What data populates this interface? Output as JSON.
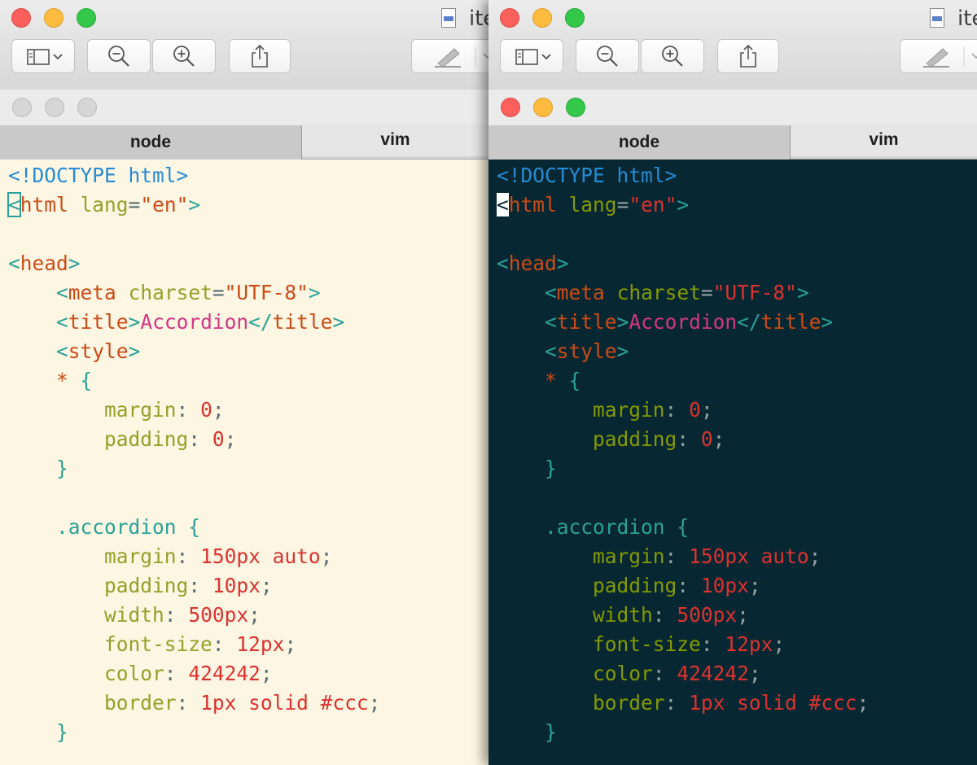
{
  "preview": {
    "title_partial": "ite"
  },
  "terminal": {
    "tabs": [
      {
        "label": "node",
        "active": true
      },
      {
        "label": "vim",
        "active": false
      }
    ]
  },
  "code": {
    "line1": {
      "a": "<!DOCTYPE html>"
    },
    "line2": {
      "cursor": "<",
      "tag": "html",
      "attr": "lang",
      "eq": "=",
      "str": "\"en\"",
      "close": ">"
    },
    "line4": {
      "open": "<",
      "tag": "head",
      "close": ">"
    },
    "line5": {
      "open": "<",
      "tag": "meta",
      "attr": "charset",
      "eq": "=",
      "str": "\"UTF-8\"",
      "close": ">"
    },
    "line6": {
      "open": "<",
      "tag": "title",
      "close": ">",
      "text": "Accordion",
      "endopen": "</",
      "endtag": "title",
      "endclose": ">"
    },
    "line7": {
      "open": "<",
      "tag": "style",
      "close": ">"
    },
    "line8": {
      "star": "*",
      "brace": "{"
    },
    "line9": {
      "prop": "margin",
      "colon": ":",
      "val": "0",
      "semi": ";"
    },
    "line10": {
      "prop": "padding",
      "colon": ":",
      "val": "0",
      "semi": ";"
    },
    "line11": {
      "brace": "}"
    },
    "line13": {
      "sel": ".accordion",
      "brace": "{"
    },
    "line14": {
      "prop": "margin",
      "colon": ":",
      "val": "150px auto",
      "semi": ";"
    },
    "line15": {
      "prop": "padding",
      "colon": ":",
      "val": "10px",
      "semi": ";"
    },
    "line16": {
      "prop": "width",
      "colon": ":",
      "val": "500px",
      "semi": ";"
    },
    "line17": {
      "prop": "font-size",
      "colon": ":",
      "val": "12px",
      "semi": ";"
    },
    "line18": {
      "prop": "color",
      "colon": ":",
      "val": "424242",
      "semi": ";"
    },
    "line19": {
      "prop": "border",
      "colon": ":",
      "val": "1px solid #ccc",
      "semi": ";"
    },
    "line20": {
      "brace": "}"
    }
  },
  "colors": {
    "light_bg": "#fdf6e3",
    "dark_bg": "#072832",
    "close": "#fc605c",
    "minimize": "#fdbc40",
    "zoom": "#34c84a"
  },
  "icons": [
    "sidebar-icon",
    "chevron-down-icon",
    "zoom-out-icon",
    "zoom-in-icon",
    "share-icon",
    "markup-pen-icon",
    "document-icon"
  ]
}
